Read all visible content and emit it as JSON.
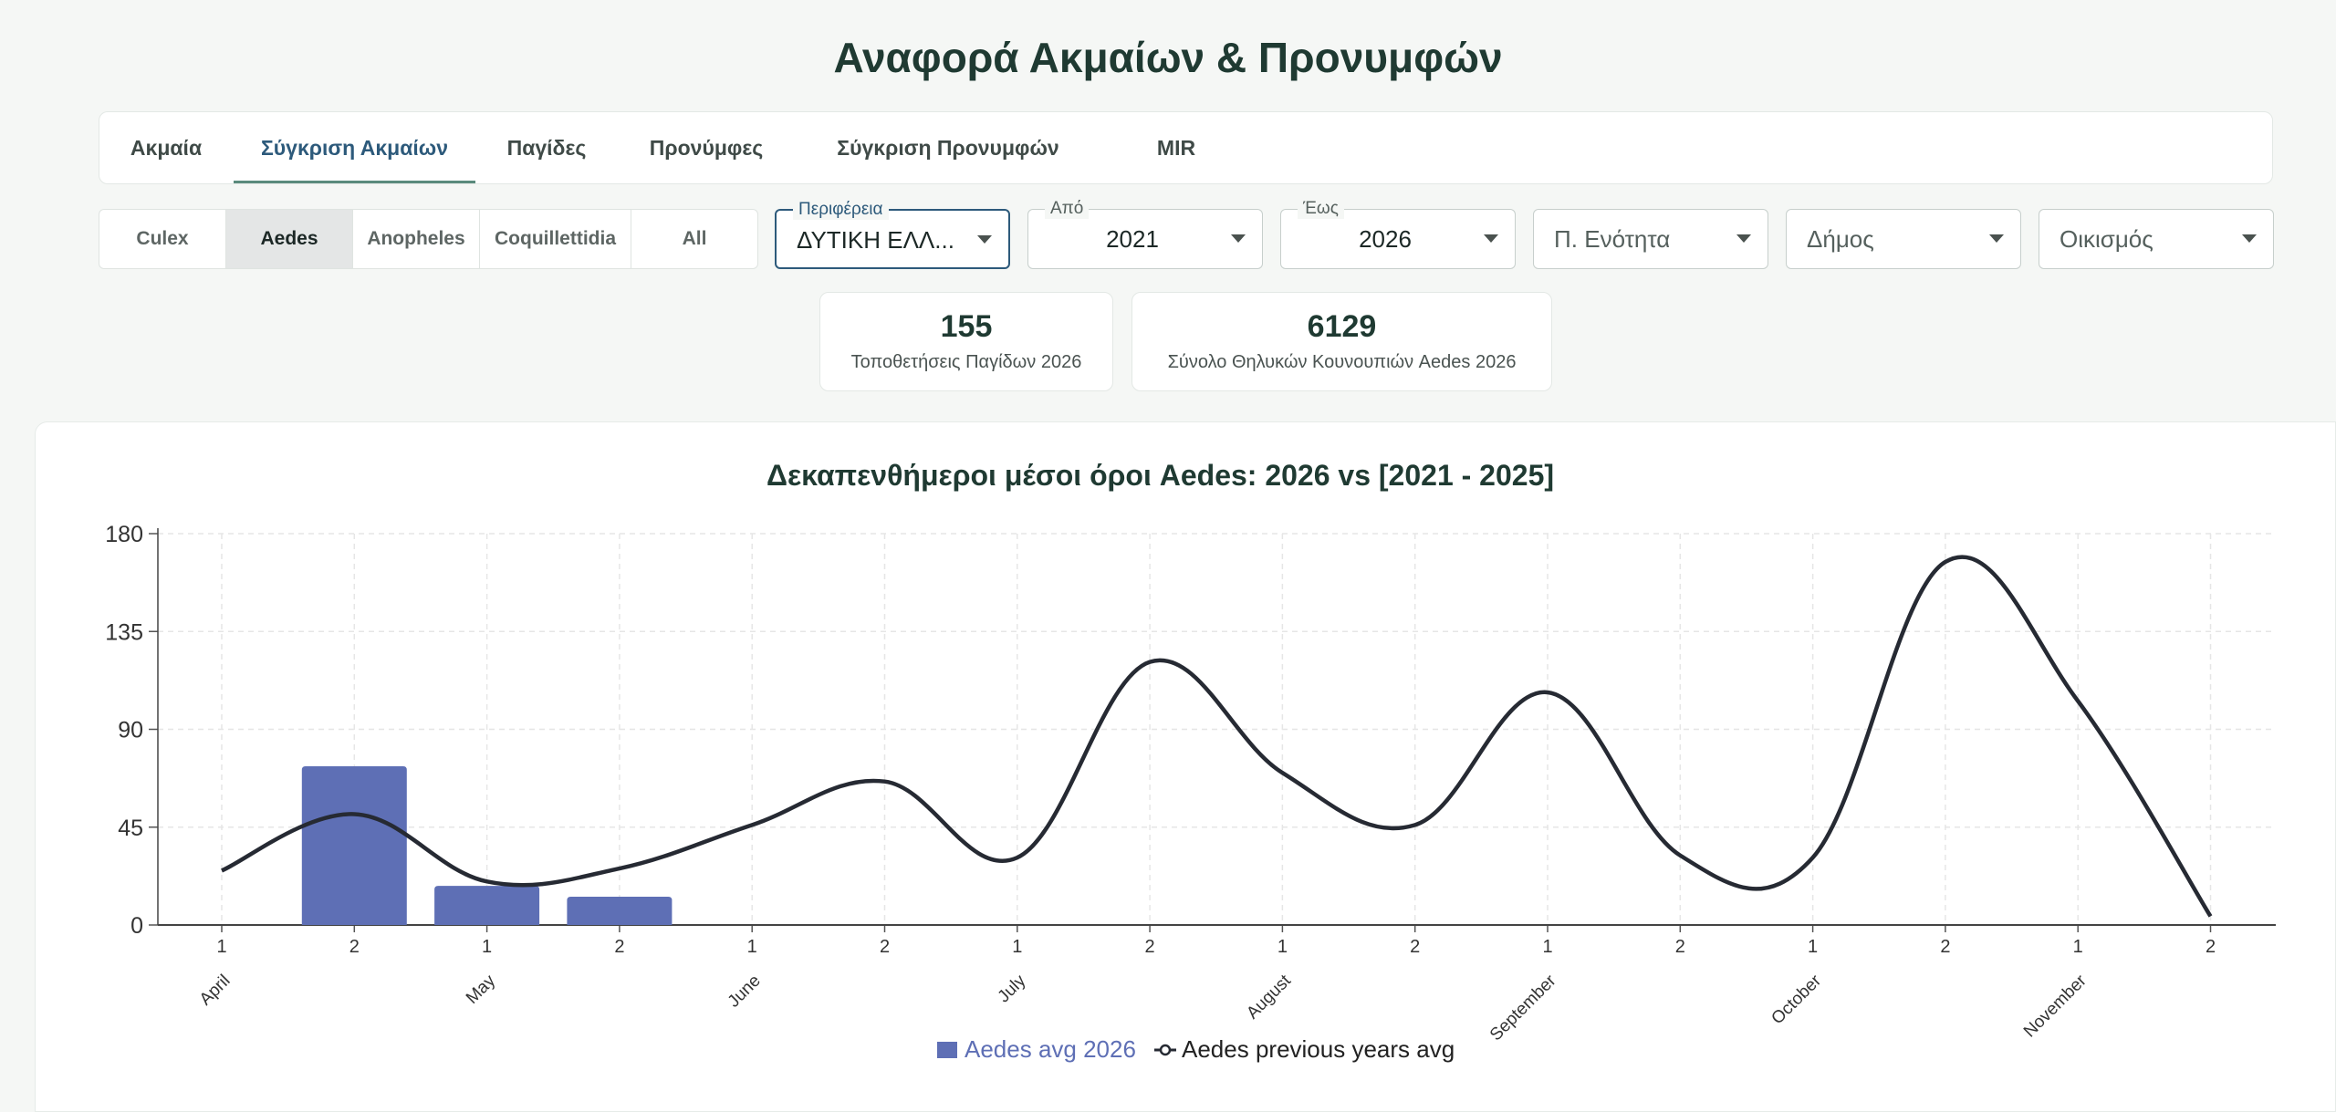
{
  "page_title": "Αναφορά Ακμαίων & Προνυμφών",
  "tabs": [
    {
      "label": "Ακμαία",
      "active": false
    },
    {
      "label": "Σύγκριση Ακμαίων",
      "active": true
    },
    {
      "label": "Παγίδες",
      "active": false
    },
    {
      "label": "Προνύμφες",
      "active": false
    },
    {
      "label": "Σύγκριση Προνυμφών",
      "active": false
    },
    {
      "label": "MIR",
      "active": false
    }
  ],
  "species": [
    {
      "label": "Culex",
      "active": false
    },
    {
      "label": "Aedes",
      "active": true
    },
    {
      "label": "Anopheles",
      "active": false
    },
    {
      "label": "Coquillettidia",
      "active": false
    },
    {
      "label": "All",
      "active": false
    }
  ],
  "filters": {
    "region": {
      "label": "Περιφέρεια",
      "value": "ΔΥΤΙΚΗ ΕΛΛ..."
    },
    "from": {
      "label": "Από",
      "value": "2021"
    },
    "to": {
      "label": "Έως",
      "value": "2026"
    },
    "unit": {
      "placeholder": "Π. Ενότητα"
    },
    "municipality": {
      "placeholder": "Δήμος"
    },
    "settlement": {
      "placeholder": "Οικισμός"
    }
  },
  "stats": [
    {
      "value": "155",
      "caption": "Τοποθετήσεις Παγίδων 2026"
    },
    {
      "value": "6129",
      "caption": "Σύνολο Θηλυκών Κουνουπιών Aedes 2026"
    }
  ],
  "colors": {
    "bar": "#5e6fb5",
    "line": "#262a33",
    "accent": "#2d5a7b"
  },
  "chart_data": {
    "type": "bar",
    "title": "Δεκαπενθήμεροι μέσοι όροι Aedes: 2026 vs [2021 - 2025]",
    "categories": [
      "1",
      "2",
      "1",
      "2",
      "1",
      "2",
      "1",
      "2",
      "1",
      "2",
      "1",
      "2",
      "1",
      "2",
      "1",
      "2"
    ],
    "months": [
      "April",
      "May",
      "June",
      "July",
      "August",
      "September",
      "October",
      "November"
    ],
    "ylim": [
      0,
      180
    ],
    "yticks": [
      0,
      45,
      90,
      135,
      180
    ],
    "grid": true,
    "legend_position": "bottom",
    "series": [
      {
        "name": "Aedes avg 2026",
        "type": "bar",
        "values": [
          null,
          73,
          18,
          13,
          null,
          null,
          null,
          null,
          null,
          null,
          null,
          null,
          null,
          null,
          null,
          null
        ]
      },
      {
        "name": "Aedes previous years avg",
        "type": "line",
        "values": [
          25,
          51,
          20,
          26,
          46,
          66,
          31,
          121,
          70,
          46,
          107,
          32,
          31,
          167,
          103,
          4
        ]
      }
    ]
  }
}
